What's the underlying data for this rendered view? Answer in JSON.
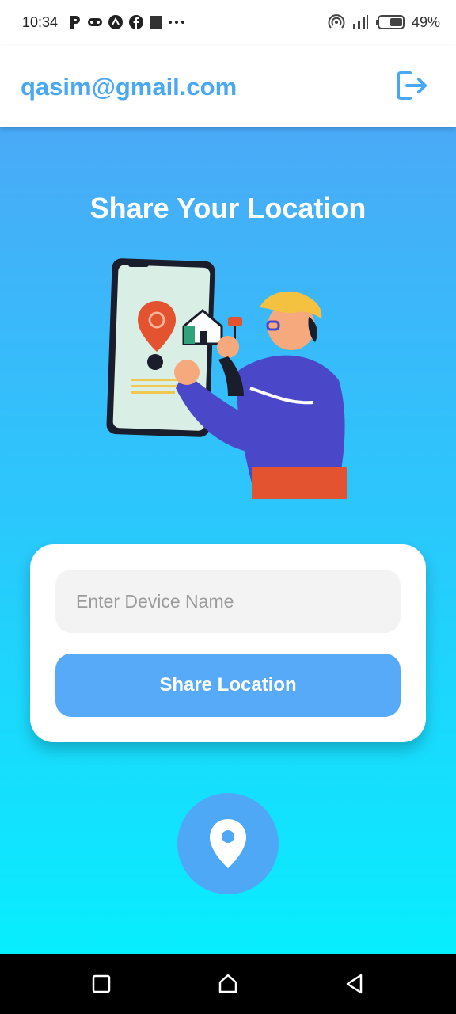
{
  "status_bar": {
    "time": "10:34",
    "battery": "49%",
    "left_icons": [
      "p-icon",
      "game-icon",
      "arrow-circle-icon",
      "facebook-icon",
      "square-icon",
      "more-dots-icon"
    ],
    "right_icons": [
      "hotspot-icon",
      "signal-icon",
      "battery-icon"
    ]
  },
  "app_bar": {
    "email": "qasim@gmail.com",
    "logout_icon": "logout-icon"
  },
  "main": {
    "title": "Share Your Location",
    "illustration_icon": "location-sharing-illustration"
  },
  "form": {
    "device_name_value": "",
    "device_name_placeholder": "Enter Device Name",
    "share_button_label": "Share Location"
  },
  "fab": {
    "icon": "location-pin-icon"
  },
  "nav_bar": {
    "buttons": [
      "recents-icon",
      "home-icon",
      "back-icon"
    ]
  },
  "colors": {
    "accent": "#4aa8f2",
    "button": "#56aaf7",
    "gradient_top": "#4aaaf7",
    "gradient_bottom": "#07eefe",
    "card": "#ffffff"
  }
}
